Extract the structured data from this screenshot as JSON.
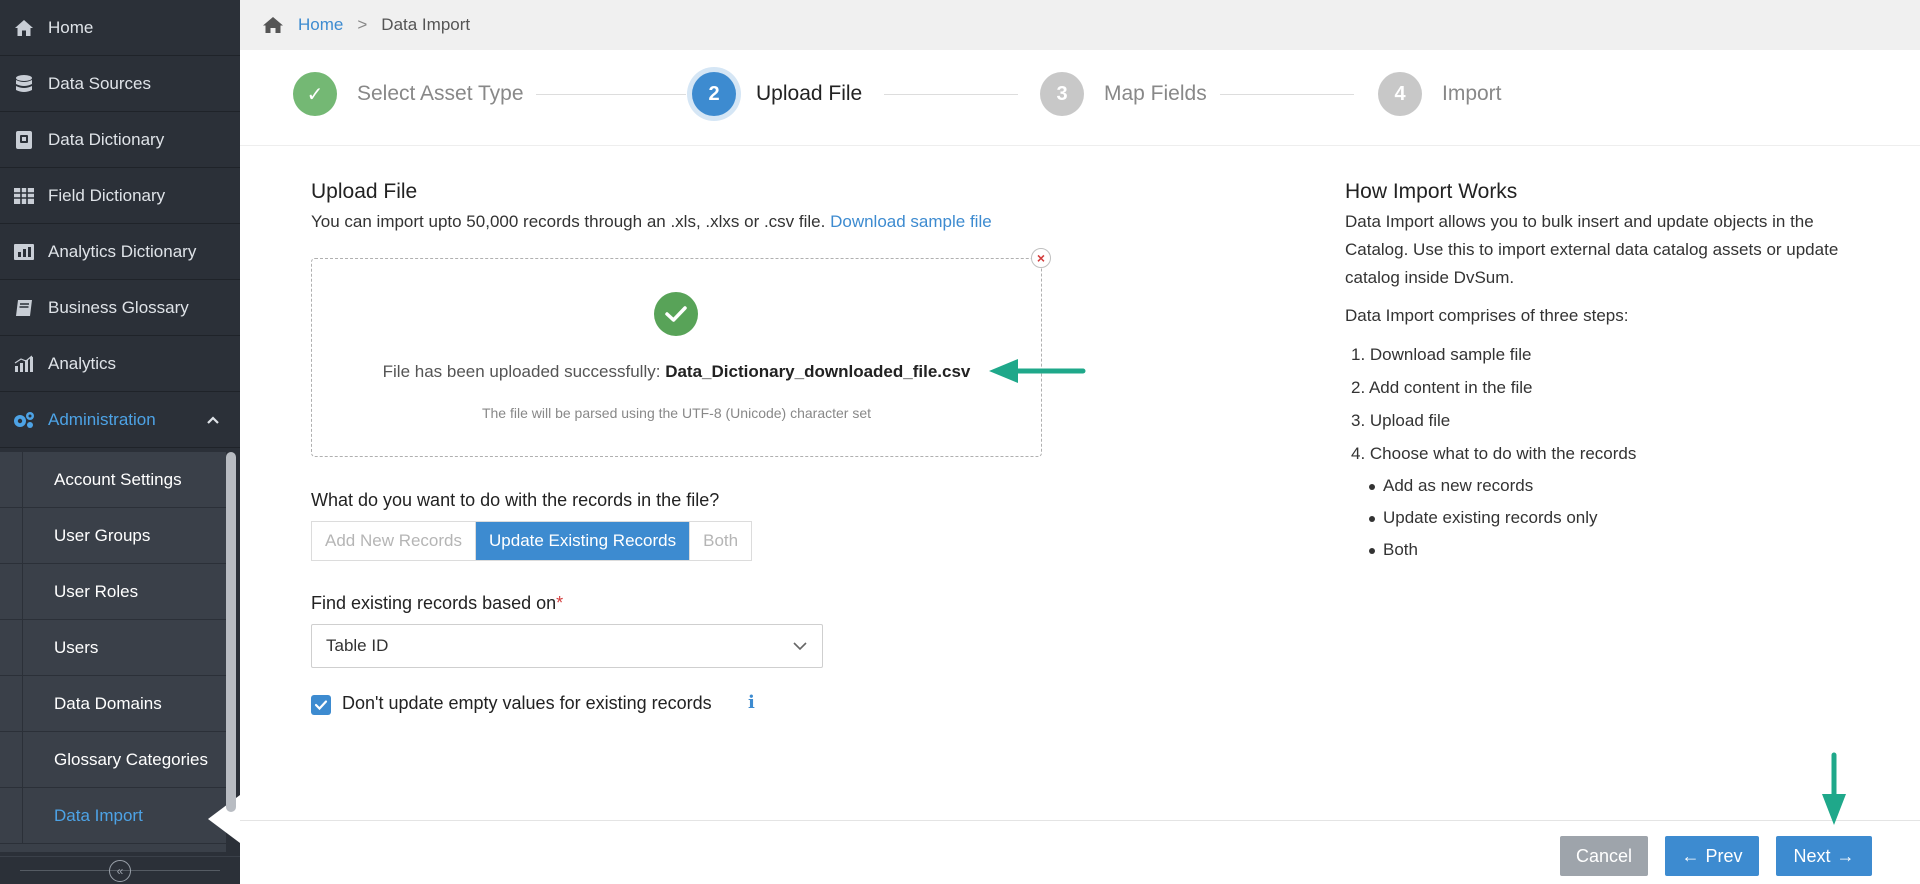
{
  "sidebar": {
    "items": [
      {
        "label": "Home",
        "icon": "home-icon"
      },
      {
        "label": "Data Sources",
        "icon": "database-icon"
      },
      {
        "label": "Data Dictionary",
        "icon": "dictionary-icon"
      },
      {
        "label": "Field Dictionary",
        "icon": "table-icon"
      },
      {
        "label": "Analytics Dictionary",
        "icon": "chart-icon"
      },
      {
        "label": "Business Glossary",
        "icon": "book-icon"
      },
      {
        "label": "Analytics",
        "icon": "bar-chart-icon"
      },
      {
        "label": "Administration",
        "icon": "gears-icon"
      }
    ],
    "admin_items": [
      {
        "label": "Account Settings"
      },
      {
        "label": "User Groups"
      },
      {
        "label": "User Roles"
      },
      {
        "label": "Users"
      },
      {
        "label": "Data Domains"
      },
      {
        "label": "Glossary Categories"
      },
      {
        "label": "Data Import"
      }
    ],
    "collapse_glyph": "«"
  },
  "breadcrumb": {
    "home": "Home",
    "separator": ">",
    "current": "Data Import"
  },
  "stepper": {
    "steps": [
      {
        "number": "✓",
        "label": "Select Asset Type"
      },
      {
        "number": "2",
        "label": "Upload File"
      },
      {
        "number": "3",
        "label": "Map Fields"
      },
      {
        "number": "4",
        "label": "Import"
      }
    ]
  },
  "upload": {
    "title": "Upload File",
    "description": "You can import upto 50,000 records through an .xls, .xlxs or .csv file.",
    "sample_link": "Download sample file",
    "success_prefix": "File has been uploaded successfully:",
    "file_name": "Data_Dictionary_downloaded_file.csv",
    "encoding_note": "The file will be parsed using the UTF-8 (Unicode) character set",
    "remove_glyph": "×"
  },
  "records": {
    "question": "What do you want to do with the records in the file?",
    "options": [
      "Add New Records",
      "Update Existing Records",
      "Both"
    ],
    "selected": "Update Existing Records"
  },
  "find": {
    "label": "Find existing records based on",
    "required_mark": "*",
    "value": "Table ID"
  },
  "empty_values": {
    "label": "Don't update empty values for existing records",
    "checked": true,
    "info_glyph": "i"
  },
  "help": {
    "title": "How Import Works",
    "intro": "Data Import allows you to bulk insert and update objects in the Catalog. Use this to import external data catalog assets or update catalog inside DvSum.",
    "steps_intro": "Data Import comprises of three steps:",
    "steps": [
      "1. Download sample file",
      "2. Add content in the file",
      "3. Upload file",
      "4. Choose what to do with the records"
    ],
    "sub_steps": [
      "Add as new records",
      "Update existing records only",
      "Both"
    ]
  },
  "footer": {
    "cancel": "Cancel",
    "prev": "Prev",
    "next": "Next",
    "prev_glyph": "←",
    "next_glyph": "→"
  },
  "colors": {
    "accent": "#3d8bd0",
    "success": "#58a358",
    "annotation_arrow": "#1fa88a",
    "sidebar_bg": "#2b3038"
  }
}
